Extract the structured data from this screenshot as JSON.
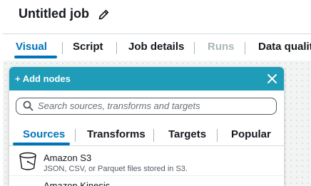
{
  "job": {
    "title": "Untitled job",
    "edit_icon": "pencil-icon"
  },
  "tabs": [
    {
      "label": "Visual",
      "active": true
    },
    {
      "label": "Script"
    },
    {
      "label": "Job details"
    },
    {
      "label": "Runs",
      "disabled": true
    },
    {
      "label": "Data qualit"
    }
  ],
  "panel": {
    "title": "+ Add nodes",
    "close_icon": "close-icon",
    "search": {
      "placeholder": "Search sources, transforms and targets",
      "value": ""
    },
    "tabs": [
      {
        "label": "Sources",
        "active": true
      },
      {
        "label": "Transforms"
      },
      {
        "label": "Targets"
      },
      {
        "label": "Popular"
      }
    ],
    "items": [
      {
        "name": "Amazon S3",
        "description": "JSON, CSV, or Parquet files stored in S3.",
        "icon": "bucket-icon"
      },
      {
        "name": "Amazon Kinesis",
        "icon": "kinesis-icon"
      }
    ]
  },
  "colors": {
    "accent": "#0073bb",
    "panel_header": "#1e9cb8"
  }
}
